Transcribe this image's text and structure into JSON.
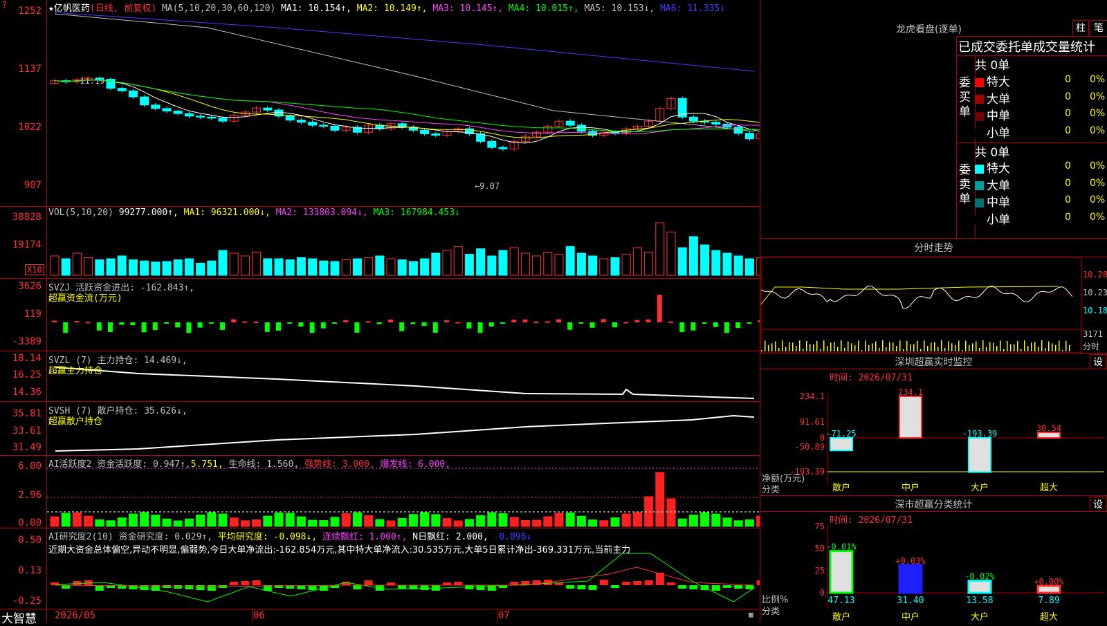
{
  "app_logo": "大智慧",
  "header": {
    "star": "★",
    "stock_name": "亿帆医药",
    "period": "(日线, 前复权)",
    "ma_label": "MA(5,10,20,30,60,120)",
    "ma_values": [
      {
        "label": "MA1: 10.154↑,",
        "color": "#ffffff"
      },
      {
        "label": "MA2: 10.149↑,",
        "color": "#ffff00"
      },
      {
        "label": "MA3: 10.145↑,",
        "color": "#ff40ff"
      },
      {
        "label": "MA4: 10.015↑,",
        "color": "#00ff00"
      },
      {
        "label": "MA5: 10.153↓,",
        "color": "#c0c0c0"
      },
      {
        "label": "MA6: 11.335↓",
        "color": "#4040ff"
      }
    ]
  },
  "price_axis": [
    "1252",
    "1137",
    "1022",
    "907"
  ],
  "price_annotations": {
    "high": "←11.19",
    "low": "←9.07"
  },
  "vol": {
    "header": "VOL(5,10,20)",
    "value": "99277.000↑,",
    "ma1": "MA1: 96321.000↓,",
    "ma2": "MA2: 133803.094↓,",
    "ma3": "MA3: 167984.453↓",
    "axis": [
      "38828",
      "19174"
    ],
    "unit": "X10"
  },
  "svzj": {
    "header": "SVZJ  活跃资金进出: -162.843↑,",
    "sub": "超赢资金流(万元)",
    "axis": [
      "3626",
      "119",
      "-3389"
    ]
  },
  "svzl": {
    "header": "SVZL (7) 主力持仓: 14.469↓,",
    "sub": "超赢主力持仓",
    "axis": [
      "18.14",
      "16.25",
      "14.36"
    ]
  },
  "svsh": {
    "header": "SVSH (7) 散户持仓: 35.626↓,",
    "sub": "超赢散户持仓",
    "axis": [
      "35.81",
      "33.61",
      "31.49"
    ]
  },
  "ai_active": {
    "h1": "AI活跃度2 资金活跃度: 0.947↑,",
    "h2": "5.751,",
    "h3": "生命线: 1.560,",
    "h4": "强势线: 3.000,",
    "h5": "爆发线: 6.000,",
    "axis": [
      "6.00",
      "2.96",
      "0.00"
    ]
  },
  "ai_research": {
    "h1": "AI研究度2(10) 资金研究度: 0.029↑,",
    "h2": "平均研究度: -0.098↓,",
    "h3": "连续飘红: 1.000↑,",
    "h4": "N日飘红: 2.000,",
    "h5": "-0.098↓",
    "comment": "近期大资金总体偏空,异动不明显,偏弱势,今日大单净流出:-162.854万元,其中特大单净流入:30.535万元,大单5日累计净出-369.331万元,当前主力",
    "axis": [
      "0.50",
      "0.13",
      "-0.25"
    ]
  },
  "date_axis": [
    "2026/05",
    "06",
    "07"
  ],
  "right": {
    "longhu_title": "龙虎看盘(逐单)",
    "btn_zhu": "柱",
    "btn_bi": "笔",
    "tabs_title": "已成交委托单成交量统计",
    "buy_label": "委买单",
    "sell_label": "委卖单",
    "buy_total": "共 0单",
    "sell_total": "共 0单",
    "buy_rows": [
      {
        "name": "特大",
        "count": "0",
        "pct": "0%",
        "color": "#ff0000"
      },
      {
        "name": "大单",
        "count": "0",
        "pct": "0%",
        "color": "#a00000"
      },
      {
        "name": "中单",
        "count": "0",
        "pct": "0%",
        "color": "#700000"
      },
      {
        "name": "小单",
        "count": "0",
        "pct": "0%",
        "color": "#000000"
      }
    ],
    "sell_rows": [
      {
        "name": "特大",
        "count": "0",
        "pct": "0%",
        "color": "#00ffff"
      },
      {
        "name": "大单",
        "count": "0",
        "pct": "0%",
        "color": "#00a0a0"
      },
      {
        "name": "中单",
        "count": "0",
        "pct": "0%",
        "color": "#007070"
      },
      {
        "name": "小单",
        "count": "0",
        "pct": "0%",
        "color": "#000000"
      }
    ],
    "intraday_title": "分时走势",
    "intraday_axis": [
      "10.28",
      "10.23",
      "10.18"
    ],
    "intraday_vol": "3171",
    "intraday_vol_label": "分时",
    "sz_monitor_title": "深圳超赢实时监控",
    "sz_monitor_settings": "设",
    "sz_time": "时间: 2026/07/31",
    "sz_axis": [
      "234.1",
      "91.61",
      "0",
      "-50.89",
      "-193.39"
    ],
    "sz_axis_label1": "净额(万元)",
    "sz_axis_label2": "分类",
    "sz_bars": [
      {
        "cat": "散户",
        "value": -71.25,
        "label": "-71.25",
        "color": "cyan"
      },
      {
        "cat": "中户",
        "value": 234.1,
        "label": "234.1",
        "color": "red"
      },
      {
        "cat": "大户",
        "value": -193.39,
        "label": "-193.39",
        "color": "cyan"
      },
      {
        "cat": "超大",
        "value": 30.54,
        "label": "30.54",
        "color": "red"
      }
    ],
    "sz_stat_title": "深市超赢分类统计",
    "sz_stat_settings": "设",
    "sz_stat_time": "时间: 2026/07/31",
    "sz_stat_axis": [
      "75",
      "50",
      "25",
      "0"
    ],
    "sz_stat_label1": "比例%",
    "sz_stat_label2": "分类",
    "sz_stat_bars": [
      {
        "cat": "散户",
        "value": 47.13,
        "label": "47.13",
        "chg": "-0.01%",
        "color": "green"
      },
      {
        "cat": "中户",
        "value": 31.4,
        "label": "31.40",
        "chg": "+0.03%",
        "color": "blue"
      },
      {
        "cat": "大户",
        "value": 13.58,
        "label": "13.58",
        "chg": "-0.02%",
        "color": "cyan"
      },
      {
        "cat": "超大",
        "value": 7.89,
        "label": "7.89",
        "chg": "+0.00%",
        "color": "red"
      }
    ]
  }
}
